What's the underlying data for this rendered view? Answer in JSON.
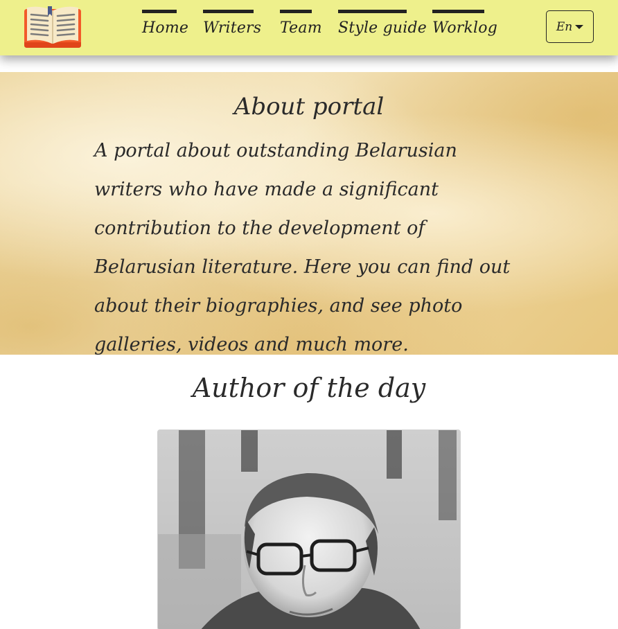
{
  "header": {
    "nav": [
      {
        "label": "Home"
      },
      {
        "label": "Writers"
      },
      {
        "label": "Team"
      },
      {
        "label": "Style guide"
      },
      {
        "label": "Worklog"
      }
    ],
    "language": "En"
  },
  "about": {
    "title": "About portal",
    "text": "A portal about outstanding Belarusian writers who have made a significant contribution to the development of Belarusian literature. Here you can find out about their biographies, and see photo galleries, videos and much more."
  },
  "author_of_day": {
    "title": "Author of the day"
  },
  "colors": {
    "header_bg": "#eef08c",
    "parchment": "#ecd49a",
    "logo_book": "#f26b3a"
  },
  "icons": {
    "logo": "open-book-icon",
    "language_caret": "caret-down-icon"
  }
}
